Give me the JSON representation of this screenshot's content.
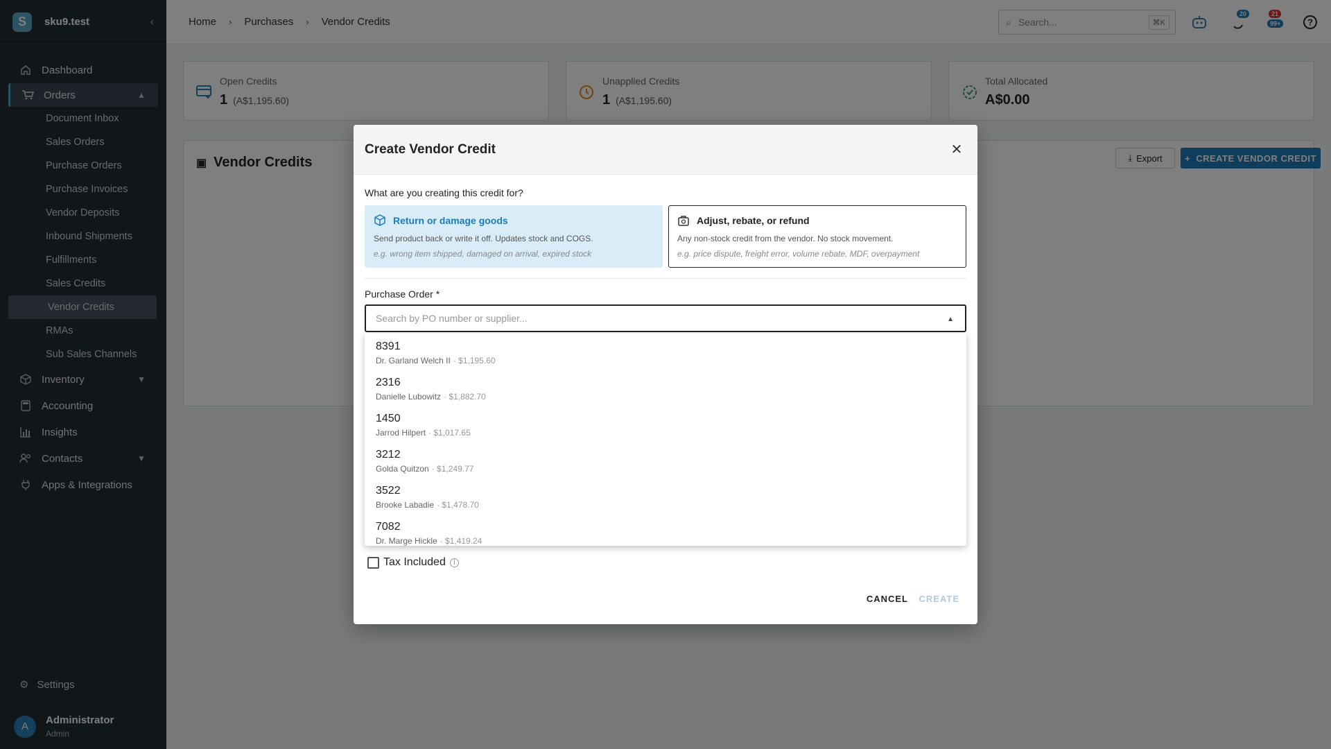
{
  "sidebar": {
    "brand": "sku9.test",
    "collapse_icon": "‹",
    "items": [
      {
        "label": "Dashboard",
        "icon": "home-icon"
      },
      {
        "label": "Orders",
        "icon": "cart-icon"
      },
      {
        "label": "Inventory",
        "icon": "box-icon"
      },
      {
        "label": "Accounting",
        "icon": "calculator-icon"
      },
      {
        "label": "Insights",
        "icon": "bar-chart-icon"
      },
      {
        "label": "Contacts",
        "icon": "users-icon"
      },
      {
        "label": "Apps & Integrations",
        "icon": "plug-icon"
      }
    ],
    "orders_sub": [
      "Document Inbox",
      "Sales Orders",
      "Purchase Orders",
      "Purchase Invoices",
      "Vendor Deposits",
      "Inbound Shipments",
      "Fulfillments",
      "Sales Credits",
      "Vendor Credits",
      "RMAs",
      "Sub Sales Channels"
    ],
    "settings_label": "Settings",
    "user": {
      "initial": "A",
      "name": "Administrator",
      "role": "Admin"
    }
  },
  "topbar": {
    "breadcrumbs": [
      "Home",
      "Purchases",
      "Vendor Credits"
    ],
    "search_placeholder": "Search...",
    "search_shortcut": "⌘K",
    "badge_notifications": "20",
    "badge_tasks_top": "21",
    "badge_tasks_bottom": "99+"
  },
  "stats": [
    {
      "label": "Open Credits",
      "value": "1",
      "sub": "(A$1,195.60)"
    },
    {
      "label": "Unapplied Credits",
      "value": "1",
      "sub": "(A$1,195.60)"
    },
    {
      "label": "Total Allocated",
      "value": "A$0.00",
      "sub": ""
    }
  ],
  "panel": {
    "title": "Vendor Credits",
    "export_label": "Export",
    "create_label": "CREATE VENDOR CREDIT"
  },
  "modal": {
    "title": "Create Vendor Credit",
    "question": "What are you creating this credit for?",
    "option1": {
      "title": "Return or damage goods",
      "desc": "Send product back or write it off. Updates stock and COGS.",
      "example": "e.g. wrong item shipped, damaged on arrival, expired stock"
    },
    "option2": {
      "title": "Adjust, rebate, or refund",
      "desc": "Any non-stock credit from the vendor. No stock movement.",
      "example": "e.g. price dispute, freight error, volume rebate, MDF, overpayment"
    },
    "po_label": "Purchase Order *",
    "po_placeholder": "Search by PO number or supplier...",
    "po_options": [
      {
        "number": "8391",
        "supplier": "Dr. Garland Welch II",
        "amount": "· $1,195.60"
      },
      {
        "number": "2316",
        "supplier": "Danielle Lubowitz",
        "amount": "· $1,882.70"
      },
      {
        "number": "1450",
        "supplier": "Jarrod Hilpert",
        "amount": "· $1,017.65"
      },
      {
        "number": "3212",
        "supplier": "Golda Quitzon",
        "amount": "· $1,249.77"
      },
      {
        "number": "3522",
        "supplier": "Brooke Labadie",
        "amount": "· $1,478.70"
      },
      {
        "number": "7082",
        "supplier": "Dr. Marge Hickle",
        "amount": "· $1,419.24"
      }
    ],
    "tax_label": "Tax Included",
    "cancel_label": "CANCEL",
    "create_label": "CREATE"
  },
  "colors": {
    "accent": "#1f7ab8",
    "sidebar": "#232c33",
    "option_selected_bg": "#d9edf8"
  }
}
